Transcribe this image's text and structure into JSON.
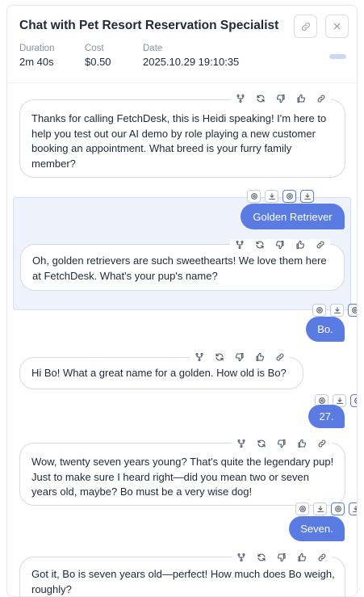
{
  "header": {
    "title": "Chat with Pet Resort Reservation Specialist",
    "meta": [
      {
        "label": "Duration",
        "value": "2m 40s"
      },
      {
        "label": "Cost",
        "value": "$0.50"
      },
      {
        "label": "Date",
        "value": "2025.10.29 19:10:35"
      }
    ],
    "link_icon": "link-icon",
    "close_icon": "close-icon"
  },
  "messages": [
    {
      "role": "assistant",
      "text": "Thanks for calling FetchDesk, this is Heidi speaking! I'm here to help you test out our AI demo by role playing a new customer booking an appointment. What breed is your furry family member?"
    },
    {
      "role": "user",
      "text": "Golden Retriever"
    },
    {
      "role": "assistant",
      "text": "Oh, golden retrievers are such sweethearts! We love them here at FetchDesk. What's your pup's name?"
    },
    {
      "role": "user",
      "text": "Bo."
    },
    {
      "role": "assistant",
      "text": "Hi Bo! What a great name for a golden. How old is Bo?"
    },
    {
      "role": "user",
      "text": "27."
    },
    {
      "role": "assistant",
      "text": "Wow, twenty seven years young? That's quite the legendary pup! Just to make sure I heard right—did you mean two or seven years old, maybe? Bo must be a very wise dog!"
    },
    {
      "role": "user",
      "text": "Seven."
    },
    {
      "role": "assistant",
      "text": "Got it, Bo is seven years old—perfect! How much does Bo weigh, roughly?"
    }
  ],
  "tool_icons": [
    "branch-icon",
    "regenerate-icon",
    "thumbs-down-icon",
    "thumbs-up-icon",
    "copy-link-icon"
  ],
  "user_tool_icons": [
    "settings-icon",
    "download-icon"
  ],
  "colors": {
    "accent": "#5a7be2",
    "selected_bg": "#eef2fb"
  }
}
